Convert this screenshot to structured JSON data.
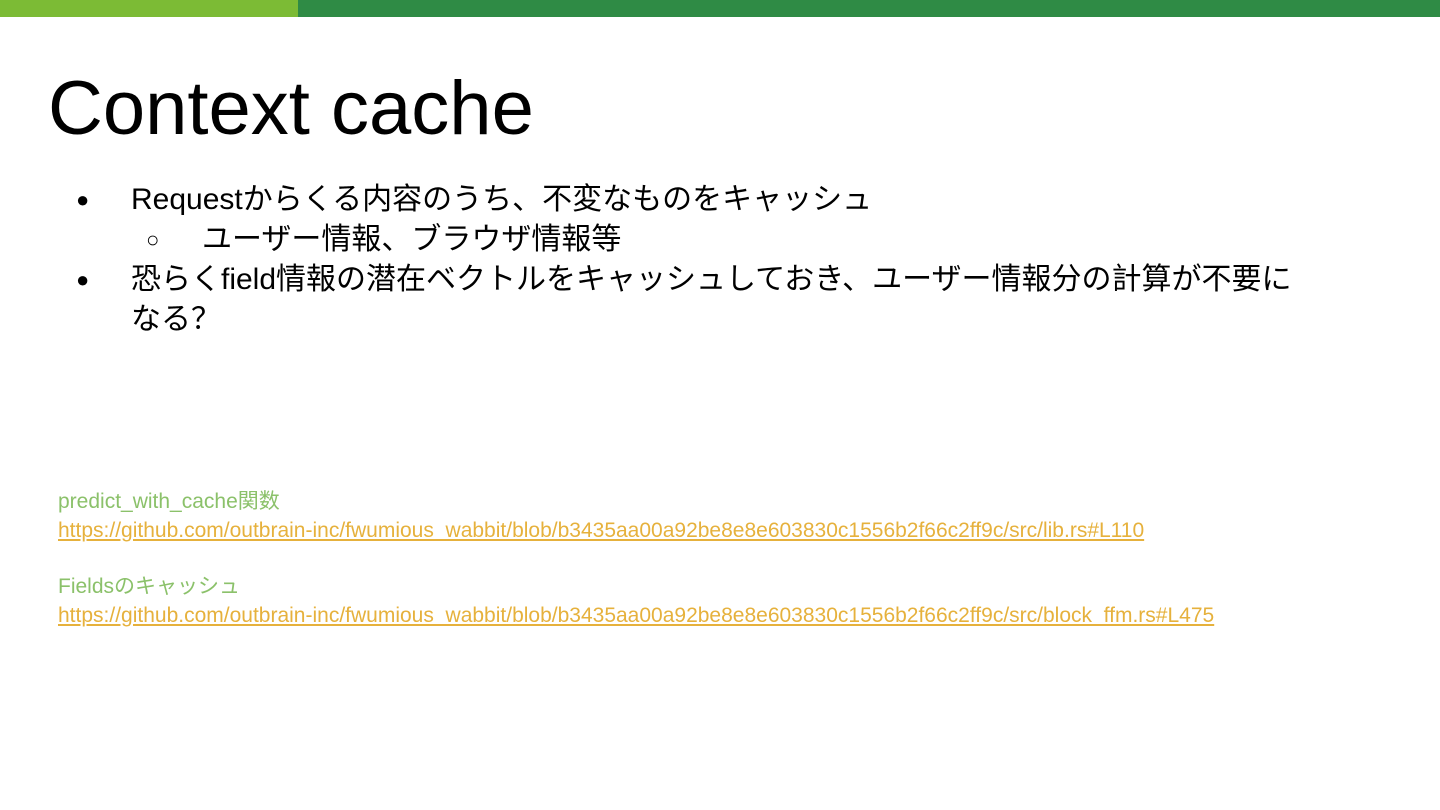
{
  "colors": {
    "bar_left": "#7cbb35",
    "bar_right": "#2f8b45",
    "label_green": "#8bc16a",
    "link_yellow": "#e6b13c",
    "text": "#000000"
  },
  "slide": {
    "title": "Context cache",
    "bullets": [
      {
        "marker": "●",
        "level": 1,
        "text": "Requestからくる内容のうち、不変なものをキャッシュ"
      },
      {
        "marker": "○",
        "level": 2,
        "text": "ユーザー情報、ブラウザ情報等"
      },
      {
        "marker": "●",
        "level": 1,
        "text": "恐らくfield情報の潜在ベクトルをキャッシュしておき、ユーザー情報分の計算が不要になる？"
      }
    ],
    "references": [
      {
        "label": "predict_with_cache関数",
        "url": "https://github.com/outbrain-inc/fwumious_wabbit/blob/b3435aa00a92be8e8e603830c1556b2f66c2ff9c/src/lib.rs#L110"
      },
      {
        "label": "Fieldsのキャッシュ",
        "url": "https://github.com/outbrain-inc/fwumious_wabbit/blob/b3435aa00a92be8e8e603830c1556b2f66c2ff9c/src/block_ffm.rs#L475"
      }
    ]
  }
}
